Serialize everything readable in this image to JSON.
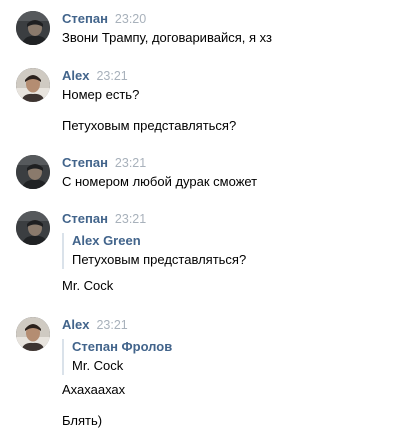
{
  "messages": [
    {
      "author": "Степан",
      "time": "23:20",
      "avatar_icon": "stepan-avatar",
      "lines": [
        "Звони Трампу, договаривайся, я хз"
      ]
    },
    {
      "author": "Alex",
      "time": "23:21",
      "avatar_icon": "alex-avatar",
      "lines": [
        "Номер есть?",
        "Петуховым представляться?"
      ]
    },
    {
      "author": "Степан",
      "time": "23:21",
      "avatar_icon": "stepan-avatar",
      "lines": [
        "С номером любой дурак сможет"
      ]
    },
    {
      "author": "Степан",
      "time": "23:21",
      "avatar_icon": "stepan-avatar",
      "quote": {
        "author": "Alex Green",
        "text": "Петуховым представляться?"
      },
      "lines": [
        "Mr. Cock"
      ]
    },
    {
      "author": "Alex",
      "time": "23:21",
      "avatar_icon": "alex-avatar",
      "quote": {
        "author": "Степан Фролов",
        "text": "Mr. Cock"
      },
      "lines": [
        "Ахахаахах",
        "Блять)"
      ]
    }
  ],
  "colors": {
    "author": "#42648b",
    "time": "#a8b1bb",
    "quote_border": "#dae2ea",
    "text": "#000000"
  }
}
